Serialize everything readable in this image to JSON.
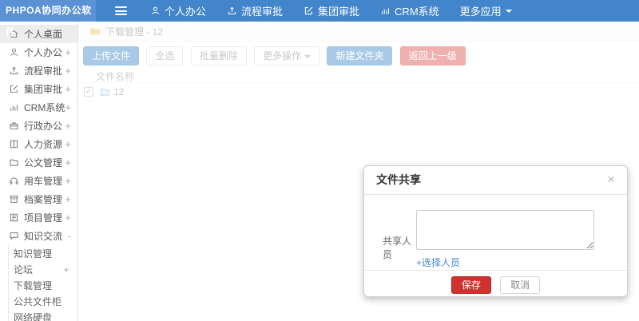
{
  "colors": {
    "navbar_blue": "#4285cb",
    "logo_blue": "#5b92d6",
    "primary_blue": "#428bca",
    "danger_red": "#d9534f",
    "save_red": "#d2322d",
    "link_blue": "#428bca"
  },
  "navbar": {
    "logo_text": "PHPOA协同办公软件",
    "items": [
      {
        "label": "个人办公",
        "icon": "user-icon"
      },
      {
        "label": "流程审批",
        "icon": "process-icon"
      },
      {
        "label": "集团审批",
        "icon": "edit-icon"
      },
      {
        "label": "CRM系统",
        "icon": "chart-icon"
      },
      {
        "label": "更多应用",
        "icon": "caret-down-icon"
      }
    ]
  },
  "sidebar": {
    "items": [
      {
        "label": "个人桌面",
        "icon": "home-icon",
        "active": true
      },
      {
        "label": "个人办公",
        "icon": "user-icon",
        "expand": "+"
      },
      {
        "label": "流程审批",
        "icon": "process-icon",
        "expand": "+"
      },
      {
        "label": "集团审批",
        "icon": "edit-icon",
        "expand": "+"
      },
      {
        "label": "CRM系统",
        "icon": "chart-icon",
        "expand": "+"
      },
      {
        "label": "行政办公",
        "icon": "briefcase-icon",
        "expand": "+"
      },
      {
        "label": "人力资源",
        "icon": "book-icon",
        "expand": "+"
      },
      {
        "label": "公文管理",
        "icon": "folder-icon",
        "expand": "+"
      },
      {
        "label": "用车管理",
        "icon": "headset-icon",
        "expand": "+"
      },
      {
        "label": "档案管理",
        "icon": "archive-icon",
        "expand": "+"
      },
      {
        "label": "项目管理",
        "icon": "document-icon",
        "expand": "+"
      },
      {
        "label": "知识交流",
        "icon": "chat-icon",
        "expand": "-",
        "expanded": true
      }
    ],
    "subitems": [
      {
        "label": "知识管理"
      },
      {
        "label": "论坛",
        "expand": "+"
      },
      {
        "label": "下载管理"
      },
      {
        "label": "公共文件柜"
      },
      {
        "label": "网络硬盘"
      }
    ]
  },
  "content": {
    "breadcrumb": "下载管理 - 12",
    "toolbar": {
      "upload": "上传文件",
      "select_all": "全选",
      "batch_delete": "批量删除",
      "more_actions": "更多操作",
      "new_folder": "新建文件夹",
      "go_back": "返回上一级"
    },
    "table": {
      "name_header": "文件名称",
      "rows": [
        {
          "name": "12",
          "checked": true,
          "check_glyph": "✓"
        }
      ]
    }
  },
  "modal": {
    "title": "文件共享",
    "close_glyph": "×",
    "share_label": "共享人员",
    "textarea_value": "",
    "textarea_placeholder": "",
    "select_people_link": "+选择人员",
    "save": "保存",
    "cancel": "取消"
  }
}
